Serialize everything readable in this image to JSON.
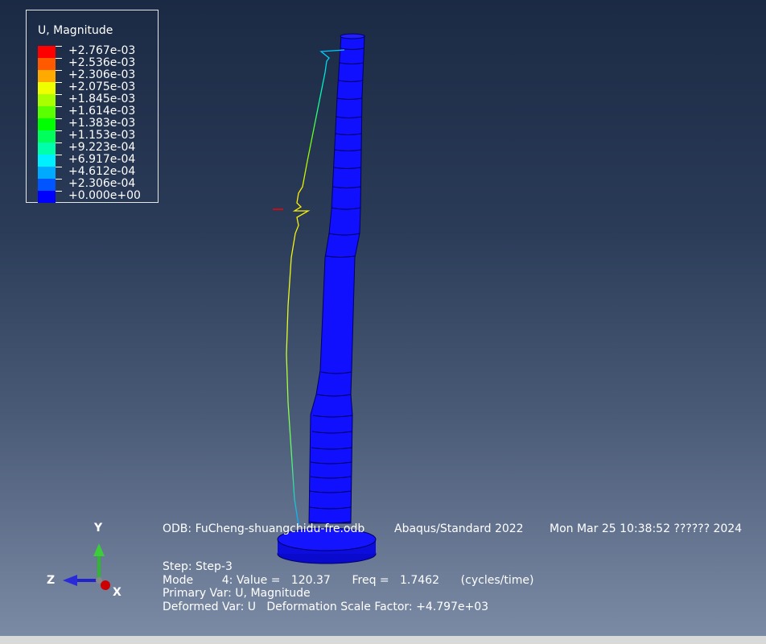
{
  "legend": {
    "title": "U, Magnitude",
    "entries": [
      {
        "value": "+2.767e-03",
        "color": "#ff0000"
      },
      {
        "value": "+2.536e-03",
        "color": "#ff5a00"
      },
      {
        "value": "+2.306e-03",
        "color": "#ffaa00"
      },
      {
        "value": "+2.075e-03",
        "color": "#f0ff00"
      },
      {
        "value": "+1.845e-03",
        "color": "#a8ff00"
      },
      {
        "value": "+1.614e-03",
        "color": "#5aff00"
      },
      {
        "value": "+1.383e-03",
        "color": "#00ff00"
      },
      {
        "value": "+1.153e-03",
        "color": "#00ff5a"
      },
      {
        "value": "+9.223e-04",
        "color": "#00ffaa"
      },
      {
        "value": "+6.917e-04",
        "color": "#00f0ff"
      },
      {
        "value": "+4.612e-04",
        "color": "#00aaff"
      },
      {
        "value": "+2.306e-04",
        "color": "#0055ff"
      },
      {
        "value": "+0.000e+00",
        "color": "#0000ff"
      }
    ]
  },
  "info": {
    "odb": "ODB: FuCheng-shuangchidu-fre.odb",
    "solver": "Abaqus/Standard 2022",
    "date": "Mon Mar 25 10:38:52 ?????? 2024",
    "step": "Step: Step-3",
    "mode": "Mode        4: Value =   120.37      Freq =   1.7462      (cycles/time)",
    "primary_var": "Primary Var: U, Magnitude",
    "deformed_var": "Deformed Var: U   Deformation Scale Factor: +4.797e+03"
  },
  "triad": {
    "y_label": "Y",
    "z_label": "Z",
    "x_label": "X",
    "y_color": "#2fb82f",
    "z_color": "#2222cc",
    "x_color": "#cc0000"
  },
  "model": {
    "body_color": "#1010ff",
    "edge_color": "#000080"
  }
}
